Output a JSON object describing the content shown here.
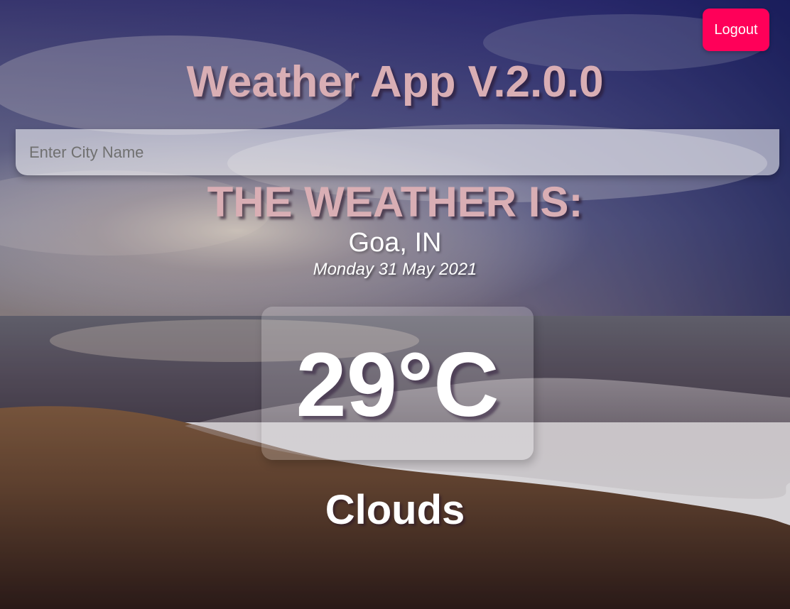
{
  "header": {
    "logout_label": "Logout",
    "app_title": "Weather App V.2.0.0"
  },
  "search": {
    "value": "",
    "placeholder": "Enter City Name"
  },
  "weather": {
    "heading": "THE WEATHER IS:",
    "location": "Goa, IN",
    "date": "Monday 31 May 2021",
    "temperature": "29°C",
    "condition": "Clouds"
  },
  "colors": {
    "accent": "#ff0059",
    "title_pink": "#d9aeb4",
    "text_white": "#ffffff"
  },
  "background": {
    "scene": "beach-sunset-image"
  }
}
